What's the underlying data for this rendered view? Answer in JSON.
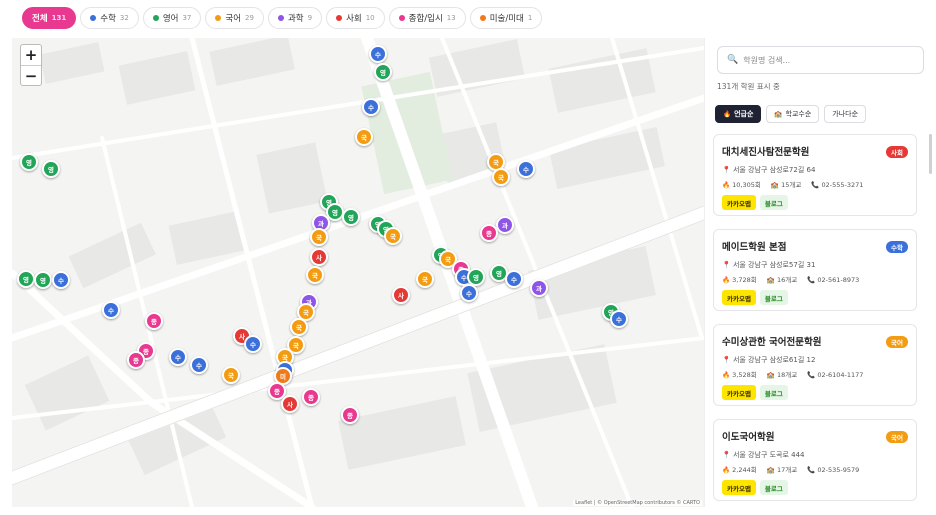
{
  "filters": [
    {
      "label": "전체",
      "count": "131",
      "color": "#e8388f",
      "active": true
    },
    {
      "label": "수학",
      "count": "32",
      "color": "#3b6fd9"
    },
    {
      "label": "영어",
      "count": "37",
      "color": "#22a559"
    },
    {
      "label": "국어",
      "count": "29",
      "color": "#f39c12"
    },
    {
      "label": "과학",
      "count": "9",
      "color": "#8e55e6"
    },
    {
      "label": "사회",
      "count": "10",
      "color": "#e53935"
    },
    {
      "label": "종합/입시",
      "count": "13",
      "color": "#e8388f"
    },
    {
      "label": "미술/미대",
      "count": "1",
      "color": "#f07a1a"
    }
  ],
  "map": {
    "zoom_in": "+",
    "zoom_out": "−",
    "attribution": "Leaflet | © OpenStreetMap contributors © CARTO"
  },
  "sidebar": {
    "search_placeholder": "학원명 검색...",
    "count_text": "131개 학원 표시 중",
    "sorts": [
      {
        "label": "언급순",
        "icon": "fire-icon",
        "active": true
      },
      {
        "label": "학교수순",
        "icon": "school-icon"
      },
      {
        "label": "가나다순",
        "icon": ""
      }
    ],
    "cards": [
      {
        "name": "대치세진사탐전문학원",
        "badge": "사회",
        "badge_color": "#e53935",
        "address": "서울 강남구 삼성로72길 64",
        "mentions": "10,305회",
        "schools": "15개교",
        "phone": "02-555-3271"
      },
      {
        "name": "메이드학원 본점",
        "badge": "수학",
        "badge_color": "#3b6fd9",
        "address": "서울 강남구 삼성로57길 31",
        "mentions": "3,728회",
        "schools": "16개교",
        "phone": "02-561-8973"
      },
      {
        "name": "수미상관한 국어전문학원",
        "badge": "국어",
        "badge_color": "#f39c12",
        "address": "서울 강남구 삼성로61길 12",
        "mentions": "3,528회",
        "schools": "18개교",
        "phone": "02-6104-1177"
      },
      {
        "name": "이도국어학원",
        "badge": "국어",
        "badge_color": "#f39c12",
        "address": "서울 강남구 도곡로 444",
        "mentions": "2,244회",
        "schools": "17개교",
        "phone": "02-535-9579"
      }
    ],
    "kakao_label": "카카오맵",
    "blog_label": "블로그"
  },
  "markers": [
    {
      "s": "수",
      "c": "#3b6fd9"
    },
    {
      "s": "영",
      "c": "#22a559"
    },
    {
      "s": "수",
      "c": "#3b6fd9"
    },
    {
      "s": "국",
      "c": "#f39c12"
    },
    {
      "s": "영",
      "c": "#22a559"
    },
    {
      "s": "영",
      "c": "#22a559"
    },
    {
      "s": "국",
      "c": "#f39c12"
    },
    {
      "s": "국",
      "c": "#f39c12"
    },
    {
      "s": "수",
      "c": "#3b6fd9"
    },
    {
      "s": "영",
      "c": "#22a559"
    },
    {
      "s": "영",
      "c": "#22a559"
    },
    {
      "s": "영",
      "c": "#22a559"
    },
    {
      "s": "과",
      "c": "#8e55e6"
    },
    {
      "s": "국",
      "c": "#f39c12"
    },
    {
      "s": "영",
      "c": "#22a559"
    },
    {
      "s": "영",
      "c": "#22a559"
    },
    {
      "s": "국",
      "c": "#f39c12"
    },
    {
      "s": "과",
      "c": "#8e55e6"
    },
    {
      "s": "종",
      "c": "#e8388f"
    },
    {
      "s": "사",
      "c": "#e53935"
    },
    {
      "s": "국",
      "c": "#f39c12"
    },
    {
      "s": "과",
      "c": "#8e55e6"
    },
    {
      "s": "국",
      "c": "#f39c12"
    },
    {
      "s": "국",
      "c": "#f39c12"
    },
    {
      "s": "영",
      "c": "#22a559"
    },
    {
      "s": "국",
      "c": "#f39c12"
    },
    {
      "s": "종",
      "c": "#e8388f"
    },
    {
      "s": "수",
      "c": "#3b6fd9"
    },
    {
      "s": "영",
      "c": "#22a559"
    },
    {
      "s": "수",
      "c": "#3b6fd9"
    },
    {
      "s": "국",
      "c": "#f39c12"
    },
    {
      "s": "영",
      "c": "#22a559"
    },
    {
      "s": "수",
      "c": "#3b6fd9"
    },
    {
      "s": "과",
      "c": "#8e55e6"
    },
    {
      "s": "사",
      "c": "#e53935"
    },
    {
      "s": "영",
      "c": "#22a559"
    },
    {
      "s": "영",
      "c": "#22a559"
    },
    {
      "s": "수",
      "c": "#3b6fd9"
    },
    {
      "s": "수",
      "c": "#3b6fd9"
    },
    {
      "s": "종",
      "c": "#e8388f"
    },
    {
      "s": "국",
      "c": "#f39c12"
    },
    {
      "s": "국",
      "c": "#f39c12"
    },
    {
      "s": "종",
      "c": "#e8388f"
    },
    {
      "s": "종",
      "c": "#e8388f"
    },
    {
      "s": "수",
      "c": "#3b6fd9"
    },
    {
      "s": "수",
      "c": "#3b6fd9"
    },
    {
      "s": "사",
      "c": "#e53935"
    },
    {
      "s": "수",
      "c": "#3b6fd9"
    },
    {
      "s": "국",
      "c": "#f39c12"
    },
    {
      "s": "수",
      "c": "#3b6fd9"
    },
    {
      "s": "미",
      "c": "#f07a1a"
    },
    {
      "s": "종",
      "c": "#e8388f"
    },
    {
      "s": "사",
      "c": "#e53935"
    },
    {
      "s": "종",
      "c": "#e8388f"
    },
    {
      "s": "종",
      "c": "#e8388f"
    },
    {
      "s": "영",
      "c": "#22a559"
    },
    {
      "s": "수",
      "c": "#3b6fd9"
    }
  ]
}
